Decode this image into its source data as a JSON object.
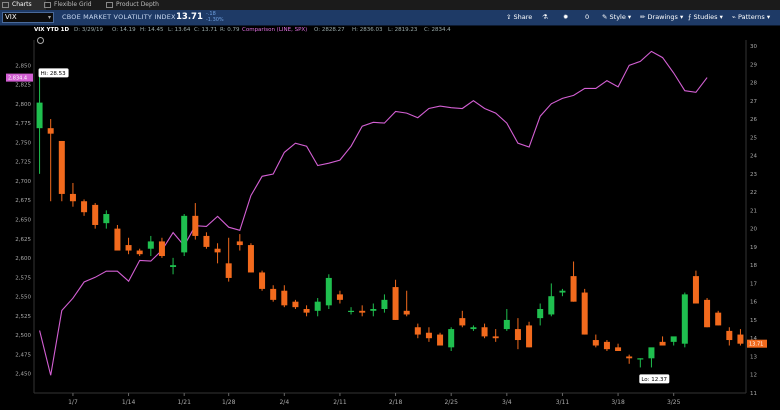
{
  "tabs": [
    {
      "label": "Charts",
      "icon": "chart-icon"
    },
    {
      "label": "Flexible Grid",
      "icon": "grid-icon"
    },
    {
      "label": "Product Depth",
      "icon": "depth-icon"
    }
  ],
  "toolbar": {
    "symbol": "VIX",
    "symbol_name": "CBOE MARKET VOLATILITY INDEX",
    "last": "13.71",
    "change_top": "-.18",
    "change_bottom": "-1.30%",
    "share": "Share",
    "count": "0",
    "style": "Style",
    "drawings": "Drawings",
    "studies": "Studies",
    "patterns": "Patterns"
  },
  "legend": {
    "title": "VIX YTD 1D",
    "date": "D: 3/29/19",
    "open": "O: 14.19",
    "high": "H: 14.45",
    "low": "L: 13.64",
    "close": "C: 13.71",
    "range": "R: 0.79",
    "comparison": "Comparison (LINE, SPX)",
    "cmp_open": "O: 2828.27",
    "cmp_high": "H: 2836.03",
    "cmp_low": "L: 2819.23",
    "cmp_close": "C: 2834.4"
  },
  "chart_data": {
    "type": "candlestick",
    "x_labels": [
      "1/7",
      "1/14",
      "1/21",
      "1/28",
      "2/4",
      "2/11",
      "2/18",
      "2/25",
      "3/4",
      "3/11",
      "3/18",
      "3/25"
    ],
    "x_label_positions": [
      3,
      8,
      13,
      17,
      22,
      27,
      32,
      37,
      42,
      47,
      52,
      57
    ],
    "right_axis": {
      "label": "VIX",
      "range": [
        11,
        30
      ],
      "ticks": [
        11,
        12,
        13,
        14,
        15,
        16,
        17,
        18,
        19,
        20,
        21,
        22,
        23,
        24,
        25,
        26,
        27,
        28,
        29,
        30
      ]
    },
    "left_axis": {
      "label": "SPX",
      "range": [
        2425,
        2875
      ],
      "ticks": [
        2450,
        2475,
        2500,
        2525,
        2550,
        2575,
        2600,
        2625,
        2650,
        2675,
        2700,
        2725,
        2750,
        2775,
        2800,
        2825,
        2850
      ]
    },
    "left_marker": "2,834.4",
    "right_marker": "13.71",
    "hi_label": "Hi: 28.53",
    "lo_label": "Lo: 12.37",
    "series": [
      {
        "name": "VIX",
        "ohlc": [
          [
            25.5,
            28.5,
            23.0,
            26.9
          ],
          [
            25.5,
            26.0,
            21.5,
            25.2
          ],
          [
            24.8,
            24.8,
            21.5,
            21.9
          ],
          [
            21.9,
            22.5,
            21.2,
            21.5
          ],
          [
            21.5,
            21.6,
            20.7,
            20.9
          ],
          [
            21.3,
            21.4,
            20.0,
            20.2
          ],
          [
            20.3,
            21.0,
            20.0,
            20.8
          ],
          [
            20.0,
            20.2,
            18.9,
            18.8
          ],
          [
            19.1,
            19.5,
            18.6,
            18.8
          ],
          [
            18.8,
            18.9,
            18.5,
            18.6
          ],
          [
            18.9,
            19.6,
            18.5,
            19.3
          ],
          [
            19.3,
            19.5,
            18.4,
            18.5
          ],
          [
            17.9,
            18.4,
            17.5,
            18.0
          ],
          [
            18.7,
            20.8,
            18.5,
            20.7
          ],
          [
            20.7,
            21.4,
            19.4,
            19.6
          ],
          [
            19.6,
            19.8,
            18.9,
            19.0
          ],
          [
            18.9,
            19.2,
            18.1,
            18.7
          ],
          [
            18.1,
            19.5,
            17.1,
            17.3
          ],
          [
            19.3,
            19.7,
            18.8,
            19.1
          ],
          [
            19.1,
            19.2,
            17.6,
            17.6
          ],
          [
            17.6,
            17.7,
            16.6,
            16.7
          ],
          [
            16.7,
            16.9,
            16.0,
            16.1
          ],
          [
            16.6,
            16.9,
            15.7,
            15.8
          ],
          [
            16.0,
            16.1,
            15.6,
            15.7
          ],
          [
            15.6,
            15.8,
            15.2,
            15.4
          ],
          [
            15.5,
            16.2,
            15.2,
            16.0
          ],
          [
            15.8,
            17.5,
            15.6,
            17.3
          ],
          [
            16.4,
            16.6,
            15.9,
            16.1
          ],
          [
            15.5,
            15.7,
            15.3,
            15.5
          ],
          [
            15.5,
            15.8,
            15.2,
            15.4
          ],
          [
            15.5,
            15.9,
            15.2,
            15.6
          ],
          [
            15.6,
            16.4,
            15.4,
            16.1
          ],
          [
            16.8,
            17.2,
            15.0,
            15.0
          ],
          [
            15.5,
            16.6,
            15.2,
            15.3
          ],
          [
            14.6,
            14.8,
            14.0,
            14.2
          ],
          [
            14.3,
            14.6,
            13.8,
            14.0
          ],
          [
            14.2,
            14.3,
            13.6,
            13.6
          ],
          [
            13.5,
            14.6,
            13.3,
            14.5
          ],
          [
            15.1,
            15.5,
            14.6,
            14.7
          ],
          [
            14.5,
            14.7,
            14.4,
            14.6
          ],
          [
            14.6,
            14.8,
            14.0,
            14.1
          ],
          [
            14.1,
            14.5,
            13.8,
            14.0
          ],
          [
            14.5,
            15.6,
            14.4,
            15.0
          ],
          [
            14.5,
            15.1,
            13.4,
            13.9
          ],
          [
            14.7,
            14.9,
            13.5,
            13.5
          ],
          [
            15.1,
            15.9,
            14.7,
            15.6
          ],
          [
            15.3,
            17.0,
            15.2,
            16.3
          ],
          [
            16.5,
            16.7,
            16.3,
            16.6
          ],
          [
            17.4,
            18.2,
            16.0,
            16.0
          ],
          [
            16.5,
            16.7,
            14.2,
            14.2
          ],
          [
            13.9,
            14.2,
            13.5,
            13.6
          ],
          [
            13.8,
            13.9,
            13.3,
            13.4
          ],
          [
            13.5,
            13.7,
            13.3,
            13.3
          ],
          [
            13.0,
            13.1,
            12.6,
            12.9
          ],
          [
            12.9,
            12.9,
            12.4,
            12.9
          ],
          [
            12.9,
            13.3,
            12.4,
            13.5
          ],
          [
            13.8,
            14.1,
            13.6,
            13.6
          ],
          [
            13.8,
            14.0,
            13.6,
            14.1
          ],
          [
            13.7,
            16.5,
            13.5,
            16.4
          ],
          [
            17.4,
            17.7,
            15.9,
            15.9
          ],
          [
            16.1,
            16.2,
            14.6,
            14.6
          ],
          [
            15.4,
            15.5,
            14.7,
            14.7
          ],
          [
            14.4,
            14.6,
            13.6,
            13.9
          ],
          [
            14.2,
            14.5,
            13.6,
            13.7
          ]
        ]
      },
      {
        "name": "SPX",
        "values": [
          2506,
          2448,
          2532,
          2548,
          2569,
          2575,
          2583,
          2583,
          2570,
          2597,
          2596,
          2610,
          2633,
          2616,
          2642,
          2641,
          2654,
          2640,
          2636,
          2681,
          2706,
          2709,
          2737,
          2749,
          2745,
          2720,
          2723,
          2727,
          2745,
          2771,
          2776,
          2775,
          2790,
          2788,
          2782,
          2794,
          2797,
          2795,
          2794,
          2804,
          2794,
          2788,
          2775,
          2749,
          2744,
          2784,
          2800,
          2807,
          2811,
          2820,
          2820,
          2830,
          2822,
          2850,
          2855,
          2868,
          2860,
          2840,
          2817,
          2815,
          2834
        ]
      }
    ]
  }
}
